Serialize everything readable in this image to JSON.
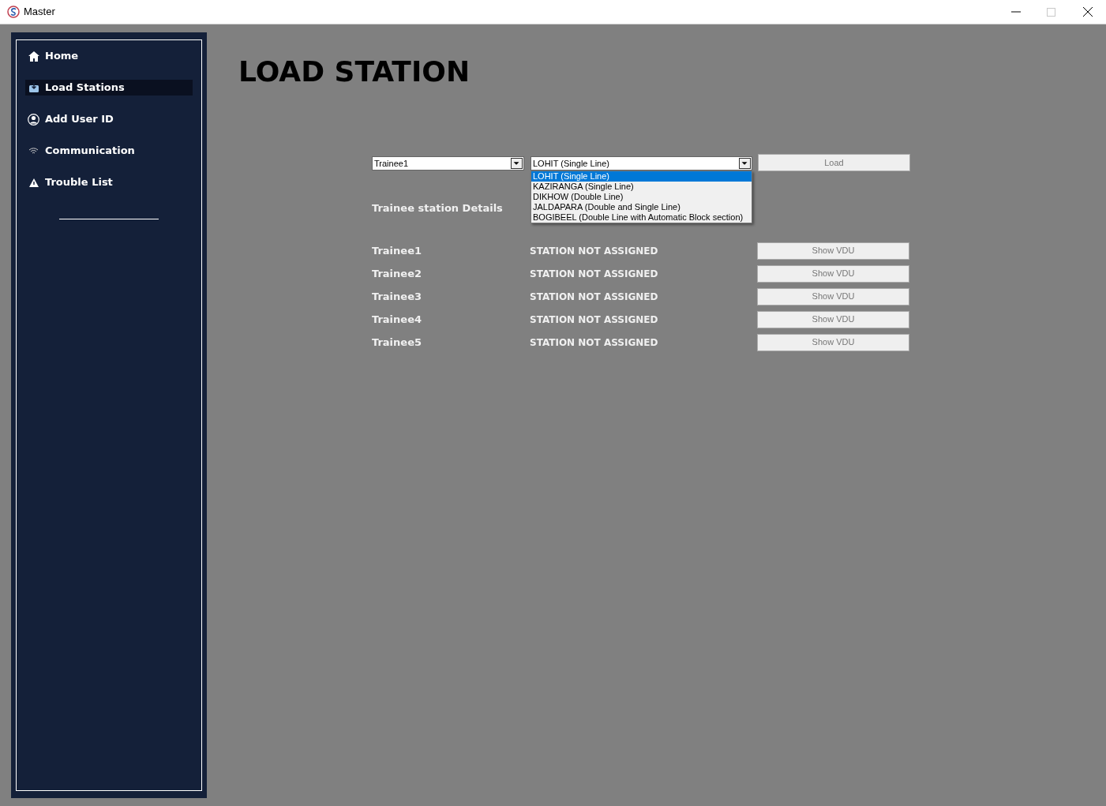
{
  "window": {
    "title": "Master"
  },
  "sidebar": {
    "items": [
      {
        "label": "Home",
        "selected": false
      },
      {
        "label": "Load Stations",
        "selected": true
      },
      {
        "label": "Add User ID",
        "selected": false
      },
      {
        "label": "Communication",
        "selected": false
      },
      {
        "label": "Trouble List",
        "selected": false
      }
    ]
  },
  "page_title": "LOAD STATION",
  "trainee_select": {
    "value": "Trainee1"
  },
  "station_select": {
    "value": "LOHIT (Single Line)",
    "expanded": true,
    "options": [
      {
        "label": "LOHIT (Single Line)",
        "selected": true
      },
      {
        "label": "KAZIRANGA (Single Line)",
        "selected": false
      },
      {
        "label": "DIKHOW (Double Line)",
        "selected": false
      },
      {
        "label": "JALDAPARA (Double and Single Line)",
        "selected": false
      },
      {
        "label": "BOGIBEEL (Double Line with Automatic Block section)",
        "selected": false
      }
    ]
  },
  "load_button": "Load",
  "details_heading": "Trainee station Details",
  "trainees": [
    {
      "name": "Trainee1",
      "status": "STATION NOT ASSIGNED",
      "button": "Show VDU"
    },
    {
      "name": "Trainee2",
      "status": "STATION NOT ASSIGNED",
      "button": "Show VDU"
    },
    {
      "name": "Trainee3",
      "status": "STATION NOT ASSIGNED",
      "button": "Show VDU"
    },
    {
      "name": "Trainee4",
      "status": "STATION NOT ASSIGNED",
      "button": "Show VDU"
    },
    {
      "name": "Trainee5",
      "status": "STATION NOT ASSIGNED",
      "button": "Show VDU"
    }
  ]
}
